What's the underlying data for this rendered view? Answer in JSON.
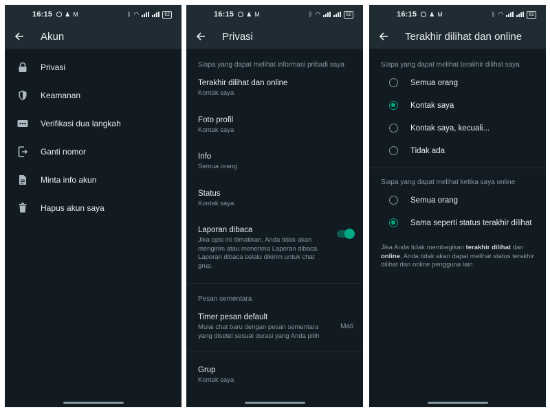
{
  "status_bar": {
    "time": "16:15",
    "battery": "62"
  },
  "screen_account": {
    "title": "Akun",
    "items": [
      {
        "label": "Privasi",
        "icon": "lock-icon"
      },
      {
        "label": "Keamanan",
        "icon": "shield-icon"
      },
      {
        "label": "Verifikasi dua langkah",
        "icon": "password-dots-icon"
      },
      {
        "label": "Ganti nomor",
        "icon": "change-number-icon"
      },
      {
        "label": "Minta info akun",
        "icon": "document-icon"
      },
      {
        "label": "Hapus akun saya",
        "icon": "trash-icon"
      }
    ]
  },
  "screen_privacy": {
    "title": "Privasi",
    "section1": "Siapa yang dapat melihat informasi pribadi saya",
    "items": [
      {
        "title": "Terakhir dilihat dan online",
        "subtitle": "Kontak saya"
      },
      {
        "title": "Foto profil",
        "subtitle": "Kontak saya"
      },
      {
        "title": "Info",
        "subtitle": "Semua orang"
      },
      {
        "title": "Status",
        "subtitle": "Kontak saya"
      }
    ],
    "read_receipts": {
      "title": "Laporan dibaca",
      "description": "Jika opsi ini dimatikan, Anda tidak akan mengirim atau menerima Laporan dibaca. Laporan dibaca selalu dikirim untuk chat grup.",
      "enabled": true
    },
    "section2": "Pesan sementara",
    "timer": {
      "title": "Timer pesan default",
      "description": "Mulai chat baru dengan pesan sementara yang disetel sesuai durasi yang Anda pilih",
      "value": "Mati"
    },
    "groups": {
      "title": "Grup",
      "subtitle": "Kontak saya"
    }
  },
  "screen_last_seen": {
    "title": "Terakhir dilihat dan online",
    "last_seen_heading": "Siapa yang dapat melihat terakhir dilihat saya",
    "last_seen_options": [
      "Semua orang",
      "Kontak saya",
      "Kontak saya, kecuali...",
      "Tidak ada"
    ],
    "last_seen_selected": "Kontak saya",
    "online_heading": "Siapa yang dapat melihat ketika saya online",
    "online_options": [
      "Semua orang",
      "Sama seperti status terakhir dilihat"
    ],
    "online_selected": "Sama seperti status terakhir dilihat",
    "footnote": {
      "part1": "Jika Anda tidak membagikan ",
      "bold1": "terakhir dilihat",
      "part2": " dan ",
      "bold2": "online",
      "part3": ", Anda tidak akan dapat melihat status terakhir dilihat dan online pengguna lain."
    }
  },
  "colors": {
    "background": "#111b21",
    "bar": "#1f2c34",
    "accent": "#00a884",
    "secondary_text": "#8696a0"
  }
}
